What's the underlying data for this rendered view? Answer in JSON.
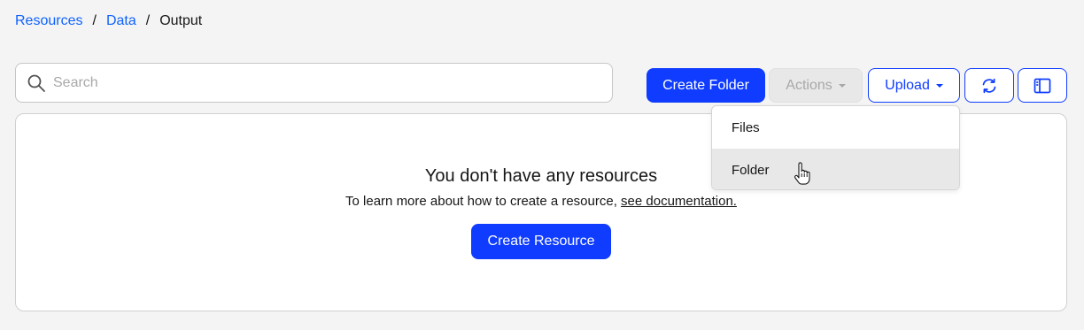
{
  "breadcrumb": {
    "items": [
      "Resources",
      "Data"
    ],
    "separator": "/",
    "current": "Output"
  },
  "search": {
    "placeholder": "Search",
    "value": ""
  },
  "toolbar": {
    "create_folder": "Create Folder",
    "actions": "Actions",
    "upload": "Upload"
  },
  "upload_menu": {
    "items": [
      "Files",
      "Folder"
    ],
    "hovered": "Folder"
  },
  "empty_state": {
    "title": "You don't have any resources",
    "description": "To learn more about how to create a resource,",
    "link": "see documentation.",
    "button": "Create Resource"
  },
  "icons": {
    "search": "search-icon",
    "refresh": "refresh-icon",
    "sidebar": "sidebar-panel-icon",
    "cursor": "hand-pointer-cursor"
  },
  "colors": {
    "primary": "#0f3cff",
    "link": "#0f62fe",
    "background": "#f4f4f4"
  }
}
